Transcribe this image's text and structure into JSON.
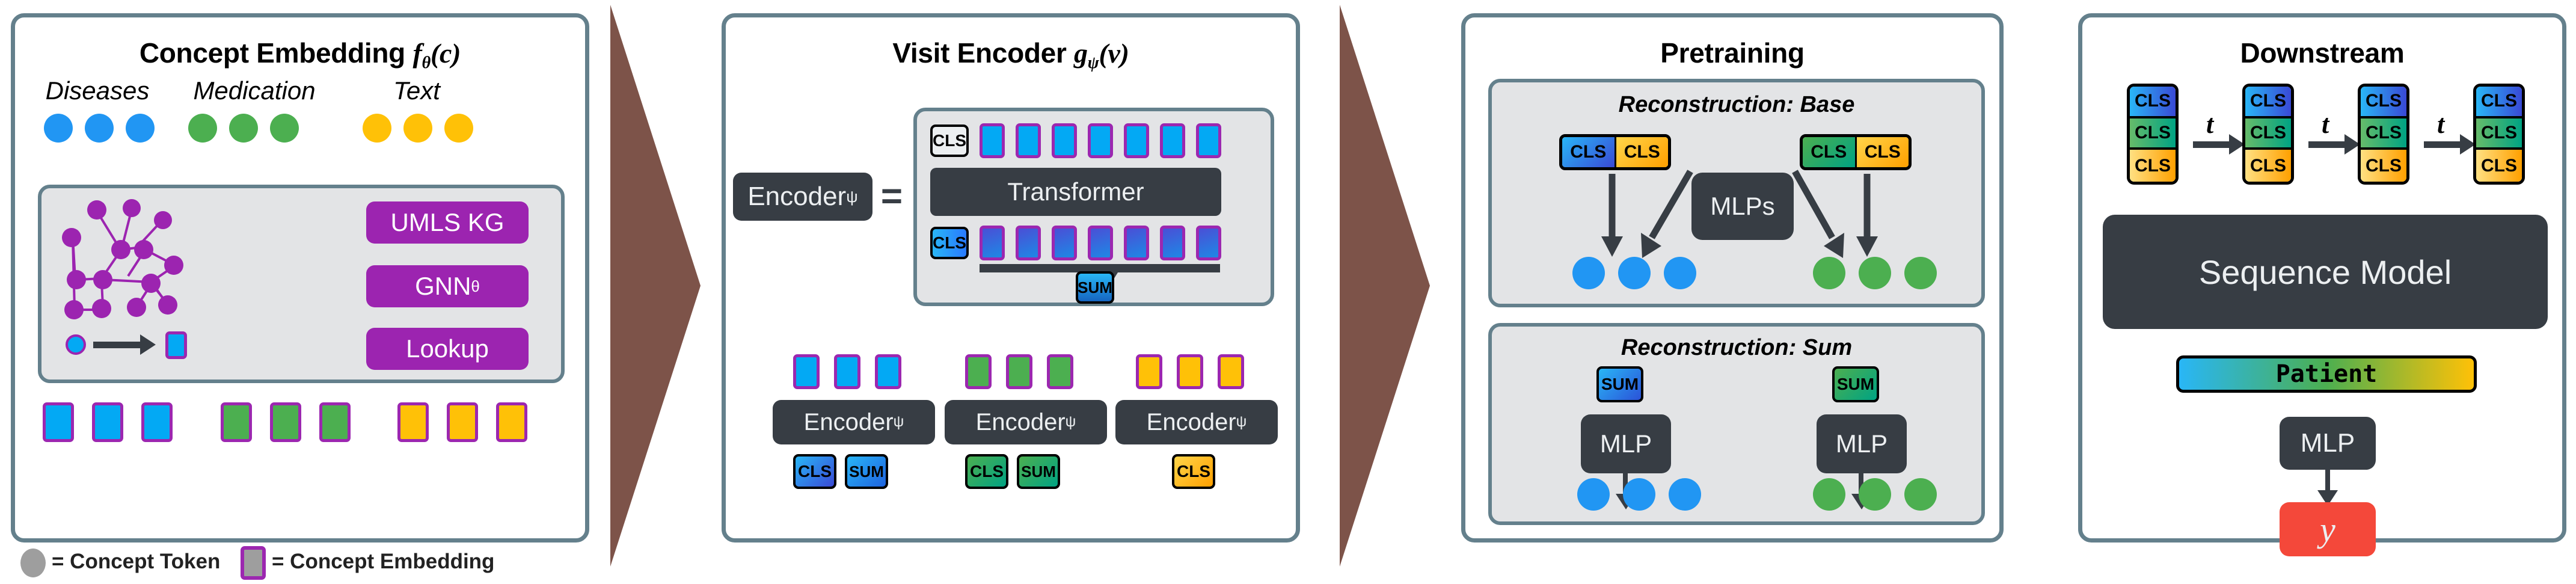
{
  "figure": {
    "legend": {
      "token_label": "= Concept Token",
      "embedding_label": "= Concept Embedding"
    }
  },
  "panels": [
    {
      "id": "concept-embedding",
      "title": "Concept Embedding fθ(c)",
      "title_base": "Concept Embedding ",
      "title_fn": "f",
      "title_sub": "θ",
      "title_arg": "(c)",
      "groups": [
        {
          "name": "Diseases",
          "label": "Diseases",
          "color": "#2196f3"
        },
        {
          "name": "Medication",
          "label": "Medication",
          "color": "#4caf50"
        },
        {
          "name": "Text",
          "label": "Text",
          "color": "#ffc107"
        }
      ],
      "methods": [
        {
          "label": "UMLS KG"
        },
        {
          "label": "GNN",
          "sub": "θ"
        },
        {
          "label": "Lookup"
        }
      ],
      "kg_caption": "",
      "embedding_rows": [
        {
          "color": "#03a9f4"
        },
        {
          "color": "#4caf50"
        },
        {
          "color": "#ffc107"
        }
      ]
    },
    {
      "id": "visit-encoder",
      "title": "Visit Encoder gψ(v)",
      "title_base": "Visit Encoder ",
      "title_fn": "g",
      "title_sub": "ψ",
      "title_arg": "(v)",
      "encoder_label": "Encoder",
      "encoder_sub": "ψ",
      "equals": "=",
      "transformer_label": "Transformer",
      "cls_label": "CLS",
      "sum_label": "SUM",
      "input_token_count": 7,
      "output_token_count": 7,
      "columns": [
        {
          "color": "#03a9f4",
          "tokens": 3,
          "outputs": [
            "CLS",
            "SUM"
          ],
          "grad_from": "#1aa3f0",
          "grad_to": "#3344cc"
        },
        {
          "color": "#4caf50",
          "tokens": 3,
          "outputs": [
            "CLS",
            "SUM"
          ],
          "grad_from": "#4caf50",
          "grad_to": "#00a07a"
        },
        {
          "color": "#ffc107",
          "tokens": 3,
          "outputs": [
            "CLS"
          ],
          "grad_from": "#ffd54a",
          "grad_to": "#ffa000"
        }
      ]
    },
    {
      "id": "pretraining",
      "title": "Pretraining",
      "sections": [
        {
          "subtitle": "Reconstruction: Base",
          "module_label": "MLPs",
          "pairs": [
            {
              "left_label": "CLS",
              "right_label": "CLS",
              "left_kind": "blue",
              "right_kind": "yellow",
              "out_color": "#2196f3"
            },
            {
              "left_label": "CLS",
              "right_label": "CLS",
              "left_kind": "green",
              "right_kind": "yellow",
              "out_color": "#4caf50"
            }
          ]
        },
        {
          "subtitle": "Reconstruction: Sum",
          "module_label": "MLP",
          "pairs": [
            {
              "token_label": "SUM",
              "kind": "blue",
              "out_color": "#2196f3"
            },
            {
              "token_label": "SUM",
              "kind": "green",
              "out_color": "#4caf50"
            }
          ]
        }
      ]
    },
    {
      "id": "downstream",
      "title": "Downstream",
      "stack_count": 4,
      "stack_labels": [
        "CLS",
        "CLS",
        "CLS"
      ],
      "step_label": "t",
      "sequence_model_label": "Sequence Model",
      "patient_label": "Patient",
      "mlp_label": "MLP",
      "output_label": "y"
    }
  ],
  "colors": {
    "panel_border": "#64808c",
    "inner_fill": "#e3e4e6",
    "dark": "#373d44",
    "purple": "#9c24b0",
    "blue": "#2196f3",
    "green": "#4caf50",
    "yellow": "#ffc107",
    "red": "#f44336",
    "brown_arrow": "#7d5349",
    "gray_legend": "#9e9e9e"
  }
}
